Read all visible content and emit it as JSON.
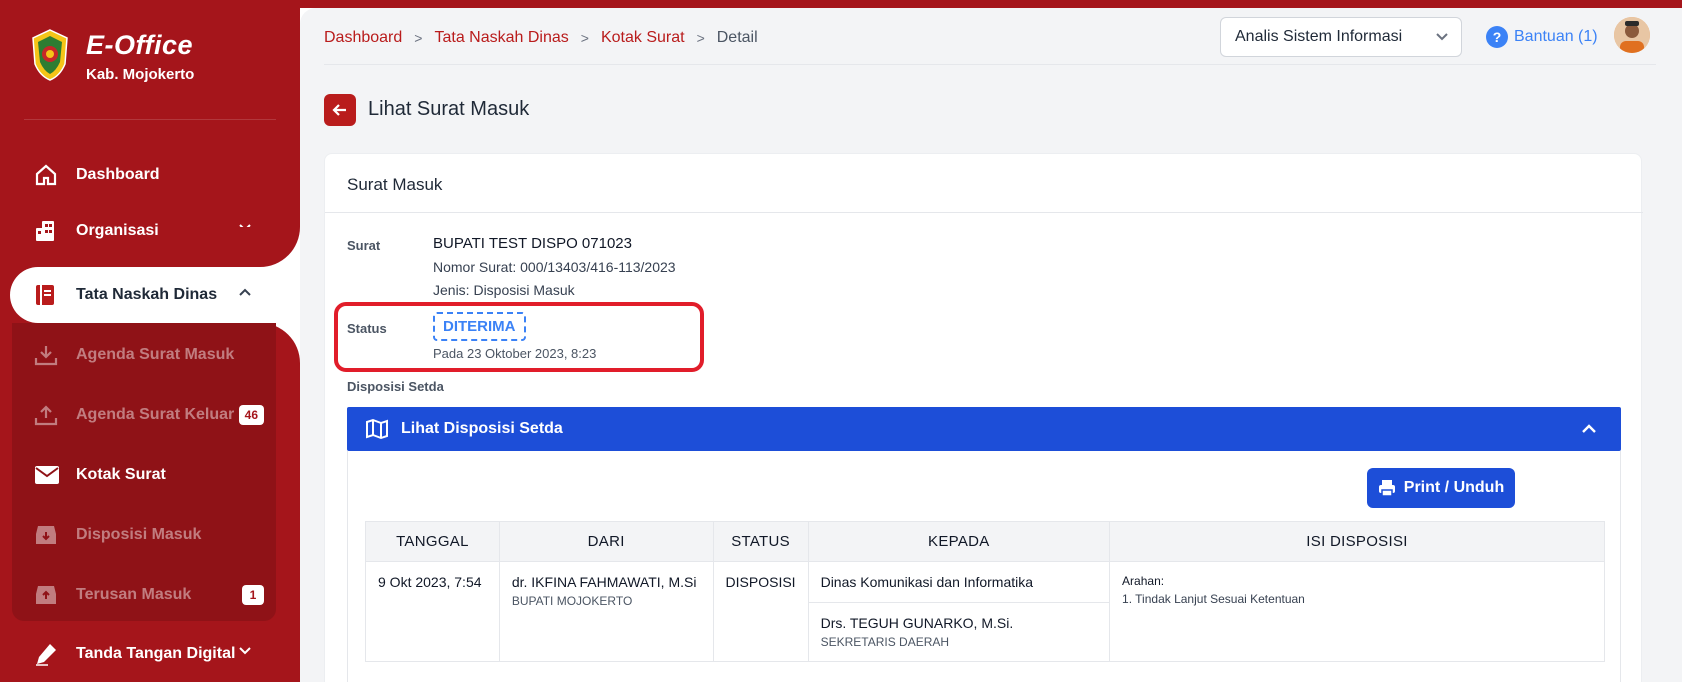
{
  "app": {
    "title": "E-Office",
    "subtitle": "Kab. Mojokerto"
  },
  "sidebar": {
    "items": [
      {
        "label": "Dashboard",
        "icon": "home-icon"
      },
      {
        "label": "Organisasi",
        "icon": "building-icon"
      },
      {
        "label": "Tata Naskah Dinas",
        "icon": "book-icon"
      },
      {
        "label": "Tanda Tangan Digital",
        "icon": "pen-icon"
      }
    ],
    "submenu": [
      {
        "label": "Agenda Surat Masuk",
        "icon": "download-icon",
        "badge": ""
      },
      {
        "label": "Agenda Surat Keluar",
        "icon": "upload-icon",
        "badge": "46"
      },
      {
        "label": "Kotak Surat",
        "icon": "mail-icon",
        "badge": ""
      },
      {
        "label": "Disposisi Masuk",
        "icon": "inbox-in-icon",
        "badge": ""
      },
      {
        "label": "Terusan Masuk",
        "icon": "inbox-out-icon",
        "badge": "1"
      }
    ]
  },
  "header": {
    "breadcrumb": [
      "Dashboard",
      "Tata Naskah Dinas",
      "Kotak Surat",
      "Detail"
    ],
    "role_selected": "Analis Sistem Informasi",
    "help_label": "Bantuan (1)"
  },
  "page": {
    "title": "Lihat Surat Masuk",
    "card_title": "Surat Masuk",
    "surat_label": "Surat",
    "surat_title": "BUPATI TEST DISPO 071023",
    "nomor_surat": "Nomor Surat: 000/13403/416-113/2023",
    "jenis": "Jenis: Disposisi Masuk",
    "status_label": "Status",
    "status_value": "DITERIMA",
    "status_date": "Pada 23 Oktober 2023, 8:23",
    "disposisi_label": "Disposisi Setda",
    "disposisi_header": "Lihat Disposisi Setda",
    "print_label": "Print / Unduh"
  },
  "table": {
    "headers": [
      "TANGGAL",
      "DARI",
      "STATUS",
      "KEPADA",
      "ISI DISPOSISI"
    ],
    "row": {
      "tanggal": "9 Okt 2023, 7:54",
      "dari_nama": "dr. IKFINA FAHMAWATI, M.Si",
      "dari_jabatan": "BUPATI MOJOKERTO",
      "status": "DISPOSISI",
      "kepada_1": "Dinas Komunikasi dan Informatika",
      "kepada_2_nama": "Drs. TEGUH GUNARKO, M.Si.",
      "kepada_2_jabatan": "SEKRETARIS DAERAH",
      "arahan_title": "Arahan:",
      "arahan_item": "1. Tindak Lanjut Sesuai Ketentuan"
    }
  },
  "colors": {
    "brand": "#a5151b",
    "accent_blue": "#1d4ed8",
    "status_blue": "#3b82f6",
    "highlight": "#e11d2a"
  }
}
